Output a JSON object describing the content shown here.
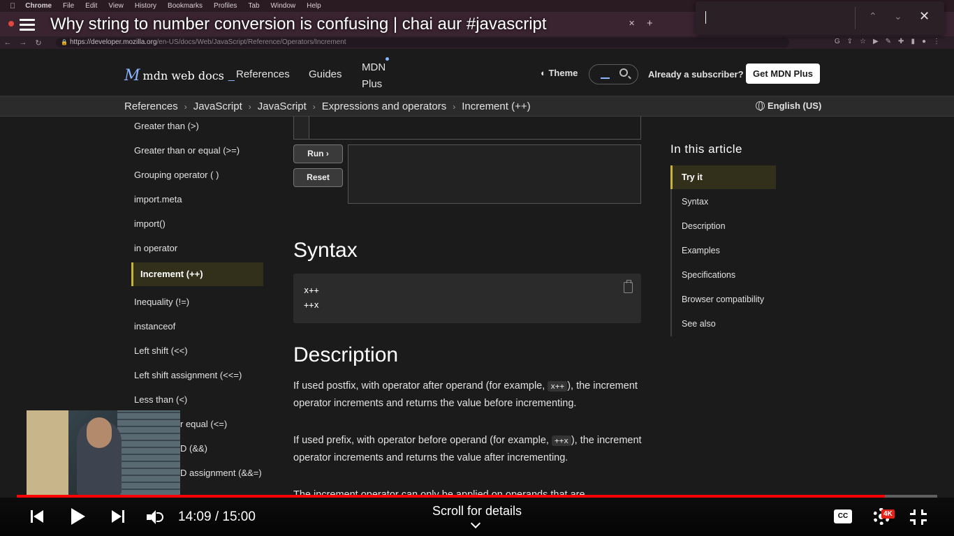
{
  "mac_menu": {
    "items": [
      "Chrome",
      "File",
      "Edit",
      "View",
      "History",
      "Bookmarks",
      "Profiles",
      "Tab",
      "Window",
      "Help"
    ]
  },
  "browser": {
    "url_host": "https://developer.mozilla.org",
    "url_path": "/en-US/docs/Web/JavaScript/Reference/Operators/Increment"
  },
  "video": {
    "title": "Why string to number conversion is confusing | chai aur #javascript",
    "time": "14:09 / 15:00",
    "scroll_hint": "Scroll for details",
    "progress": 0.943,
    "quality_badge": "4K",
    "cc_label": "CC"
  },
  "mdn_header": {
    "logo_text": "mdn web docs",
    "nav": [
      "References",
      "Guides"
    ],
    "plus_line1": "MDN",
    "plus_line2": "Plus",
    "theme": "Theme",
    "subscriber": "Already a subscriber?",
    "get_plus": "Get MDN Plus"
  },
  "breadcrumbs": [
    "References",
    "JavaScript",
    "JavaScript",
    "Expressions and operators",
    "Increment (++)"
  ],
  "language": "English (US)",
  "sidebar": {
    "items": [
      "Greater than (>)",
      "Greater than or equal (>=)",
      "Grouping operator ( )",
      "import.meta",
      "import()",
      "in operator",
      "Increment (++)",
      "Inequality (!=)",
      "instanceof",
      "Left shift (<<)",
      "Left shift assignment (<<=)",
      "Less than (<)",
      "r equal (<=)",
      "D (&&)",
      "D assignment (&&=)"
    ]
  },
  "main": {
    "run_label": "Run ›",
    "reset_label": "Reset",
    "syntax_heading": "Syntax",
    "syntax_code": [
      "x++",
      "++x"
    ],
    "description_heading": "Description",
    "para1_before": "If used postfix, with operator after operand (for example, ",
    "para1_code": "x++",
    "para1_after": "), the increment operator increments and returns the value before incrementing.",
    "para2_before": "If used prefix, with operator before operand (for example, ",
    "para2_code": "++x",
    "para2_after": "), the increment operator increments and returns the value after incrementing.",
    "para3_partial": "The increment operator can only be applied on operands that are"
  },
  "toc": {
    "title": "In this article",
    "items": [
      "Try it",
      "Syntax",
      "Description",
      "Examples",
      "Specifications",
      "Browser compatibility",
      "See also"
    ]
  }
}
